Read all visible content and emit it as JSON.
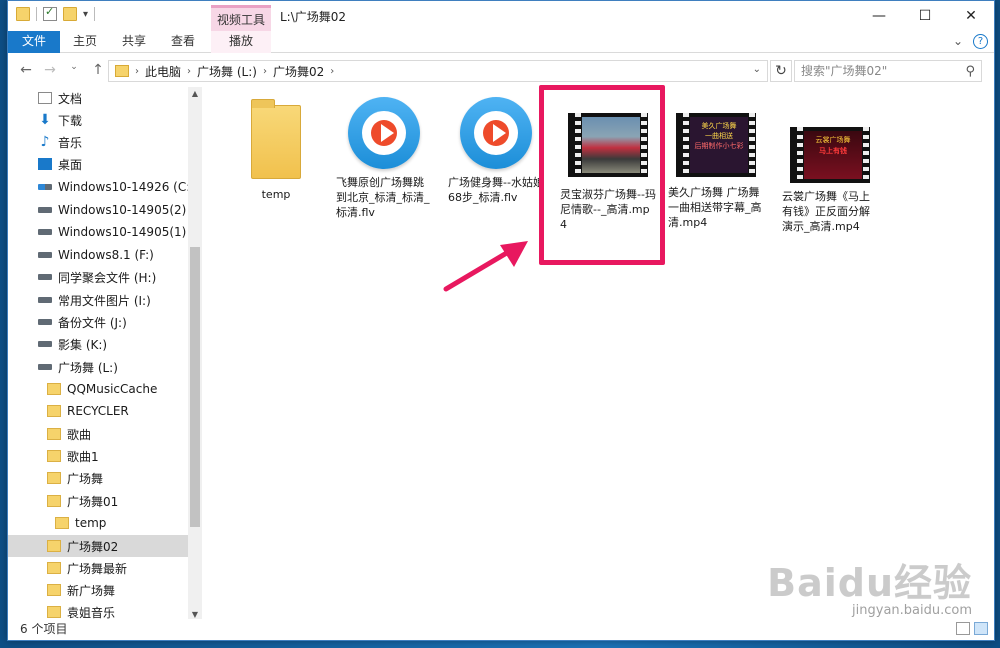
{
  "window": {
    "title": "L:\\广场舞02",
    "context_tab": "视频工具"
  },
  "ribbon": {
    "tabs": [
      "文件",
      "主页",
      "共享",
      "查看",
      "播放"
    ]
  },
  "address": {
    "breadcrumb": [
      "此电脑",
      "广场舞 (L:)",
      "广场舞02"
    ],
    "search_placeholder": "搜索\"广场舞02\""
  },
  "sidebar": {
    "items": [
      {
        "label": "文档",
        "icon": "document-icon"
      },
      {
        "label": "下载",
        "icon": "download-icon"
      },
      {
        "label": "音乐",
        "icon": "music-icon"
      },
      {
        "label": "桌面",
        "icon": "desktop-icon"
      },
      {
        "label": "Windows10-14926 (C:)",
        "icon": "windows-drive-icon"
      },
      {
        "label": "Windows10-14905(2) (D",
        "icon": "drive-icon"
      },
      {
        "label": "Windows10-14905(1) (E:",
        "icon": "drive-icon"
      },
      {
        "label": "Windows8.1 (F:)",
        "icon": "drive-icon"
      },
      {
        "label": "同学聚会文件 (H:)",
        "icon": "drive-icon"
      },
      {
        "label": "常用文件图片 (I:)",
        "icon": "drive-icon"
      },
      {
        "label": "备份文件 (J:)",
        "icon": "drive-icon"
      },
      {
        "label": "影集 (K:)",
        "icon": "drive-icon"
      },
      {
        "label": "广场舞 (L:)",
        "icon": "drive-icon"
      },
      {
        "label": "QQMusicCache",
        "icon": "folder-icon"
      },
      {
        "label": "RECYCLER",
        "icon": "folder-icon"
      },
      {
        "label": "歌曲",
        "icon": "folder-icon"
      },
      {
        "label": "歌曲1",
        "icon": "folder-icon"
      },
      {
        "label": "广场舞",
        "icon": "folder-icon"
      },
      {
        "label": "广场舞01",
        "icon": "folder-icon"
      },
      {
        "label": "temp",
        "icon": "folder-icon"
      },
      {
        "label": "广场舞02",
        "icon": "folder-icon",
        "selected": true
      },
      {
        "label": "广场舞最新",
        "icon": "folder-icon"
      },
      {
        "label": "新广场舞",
        "icon": "folder-icon"
      },
      {
        "label": "袁姐音乐",
        "icon": "folder-icon"
      }
    ]
  },
  "files": [
    {
      "name": "temp",
      "type": "folder"
    },
    {
      "name": "飞舞原创广场舞跳到北京_标清_标清_标清.flv",
      "type": "flv"
    },
    {
      "name": "广场健身舞--水姑娘 68步_标清.flv",
      "type": "flv"
    },
    {
      "name": "灵宝淑芬广场舞--玛尼情歌--_高清.mp4",
      "type": "mp4",
      "highlighted": true
    },
    {
      "name": "美久广场舞 广场舞一曲相送带字幕_高清.mp4",
      "type": "mp4"
    },
    {
      "name": "云裳广场舞《马上有钱》正反面分解演示_高清.mp4",
      "type": "mp4"
    }
  ],
  "thumb_text": {
    "t4a": "美久广场舞",
    "t4b": "一曲相送",
    "t4c": "后期制作小七彩",
    "t5a": "云裳广场舞",
    "t5b": "马上有钱"
  },
  "status": {
    "count": "6 个项目"
  },
  "watermark": {
    "brand": "Baidu经验",
    "url": "jingyan.baidu.com"
  },
  "colors": {
    "accent": "#1979ca",
    "highlight": "#e8185f",
    "context_tab": "#f7d7e6"
  }
}
